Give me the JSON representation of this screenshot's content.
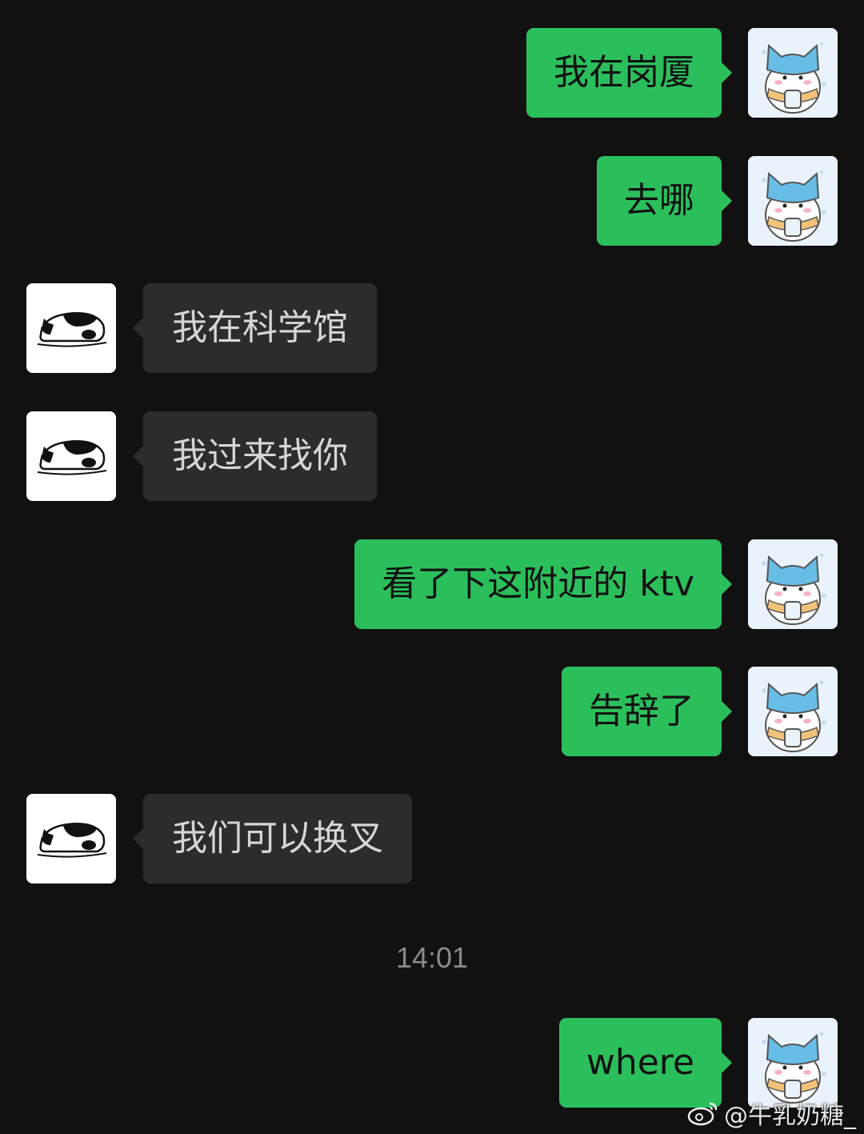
{
  "messages": [
    {
      "side": "me",
      "text": "我在岗厦"
    },
    {
      "side": "me",
      "text": "去哪"
    },
    {
      "side": "them",
      "text": "我在科学馆"
    },
    {
      "side": "them",
      "text": "我过来找你"
    },
    {
      "side": "me",
      "text": "看了下这附近的 ktv"
    },
    {
      "side": "me",
      "text": "告辞了"
    },
    {
      "side": "them",
      "text": "我们可以换叉"
    },
    {
      "side": "me",
      "text": "where"
    }
  ],
  "timestamp": "14:01",
  "watermark": {
    "text": "@牛乳奶糖_",
    "icon": "weibo-icon"
  },
  "avatars": {
    "me": "blue-cat-sticker-avatar",
    "them": "sleeping-cat-avatar"
  },
  "colors": {
    "background": "#111111",
    "my_bubble": "#2bbf5c",
    "their_bubble": "#2c2c2c",
    "timestamp": "#8a8a8a"
  }
}
